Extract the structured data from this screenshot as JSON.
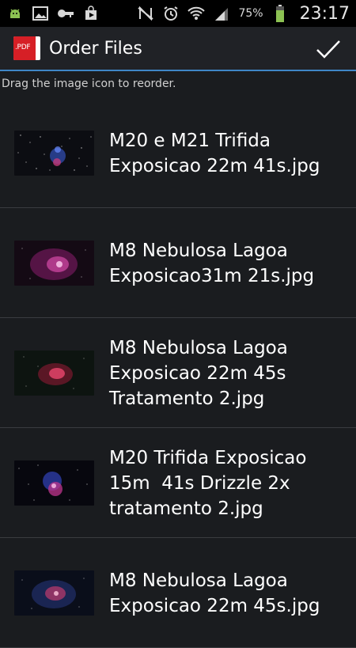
{
  "status_bar": {
    "battery_percent_label": "75%",
    "battery_level": 0.75,
    "time": "23:17",
    "icons_left": [
      "android-debug-icon",
      "image-icon",
      "key-icon",
      "play-store-icon"
    ],
    "icons_right": [
      "nfc-muted-icon",
      "alarm-icon",
      "wifi-icon",
      "signal-icon",
      "battery-icon"
    ]
  },
  "action_bar": {
    "app_icon_text": ".PDF",
    "title": "Order Files",
    "done_icon": "check-icon",
    "accent_color": "#3f86c7"
  },
  "hint": "Drag the image icon to reorder.",
  "files": [
    {
      "name": "M20 e M21 Trifida\nExposicao 22m 41s.jpg",
      "thumb": "starfield-blue"
    },
    {
      "name": "M8 Nebulosa Lagoa\nExposicao31m 21s.jpg",
      "thumb": "nebula-magenta"
    },
    {
      "name": "M8 Nebulosa Lagoa\nExposicao 22m 45s\nTratamento 2.jpg",
      "thumb": "nebula-red"
    },
    {
      "name": "M20 Trifida Exposicao\n15m  41s Drizzle 2x\ntratamento 2.jpg",
      "thumb": "nebula-blue-pink"
    },
    {
      "name": "M8 Nebulosa Lagoa\nExposicao 22m 45s.jpg",
      "thumb": "nebula-pink-blue"
    }
  ]
}
